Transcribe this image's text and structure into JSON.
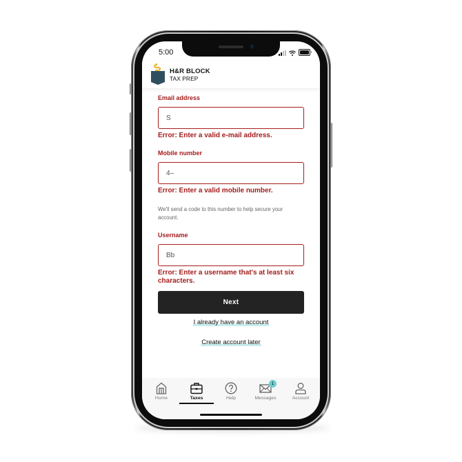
{
  "status_bar": {
    "time": "5:00"
  },
  "header": {
    "brand_name": "H&R BLOCK",
    "brand_sub": "TAX PREP",
    "logo_icon": "hr-block-pocket-logo",
    "colors": {
      "logo_pocket": "#2f4f5f",
      "logo_dollar": "#e8b83a"
    }
  },
  "form": {
    "email": {
      "label": "Email address",
      "value": "S",
      "error": "Error: Enter a valid e-mail address."
    },
    "mobile": {
      "label": "Mobile number",
      "value": "4–",
      "error": "Error: Enter a valid mobile number.",
      "helper": "We'll send a code to this number to help secure your account."
    },
    "username": {
      "label": "Username",
      "value": "Bb",
      "error": "Error: Enter a username that's at least six characters."
    },
    "next_label": "Next",
    "have_account_link": "I already have an account",
    "later_link": "Create account later"
  },
  "tabbar": {
    "items": [
      {
        "label": "Home",
        "icon": "home-icon"
      },
      {
        "label": "Taxes",
        "icon": "briefcase-icon",
        "active": true
      },
      {
        "label": "Help",
        "icon": "help-icon"
      },
      {
        "label": "Messages",
        "icon": "envelope-icon",
        "badge": "1"
      },
      {
        "label": "Account",
        "icon": "user-icon"
      }
    ]
  },
  "colors": {
    "error": "#a51c1c",
    "primary_button": "#232323",
    "badge": "#6ccfcf",
    "link_highlight": "#c8eeee"
  }
}
